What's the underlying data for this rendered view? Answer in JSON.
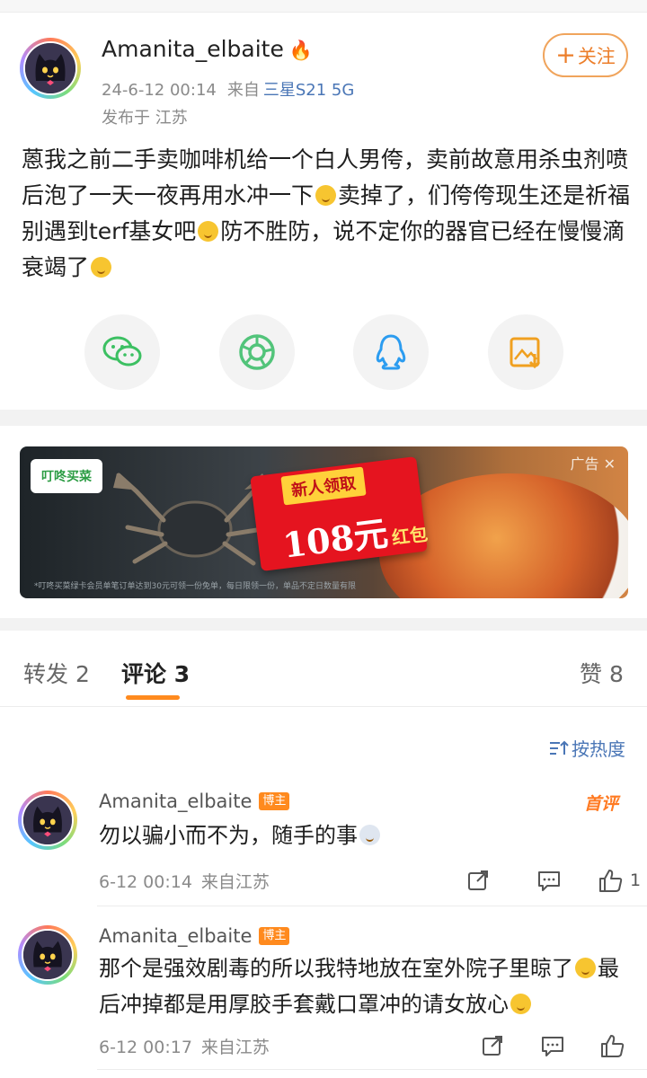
{
  "post": {
    "username": "Amanita_elbaite",
    "time": "24-6-12 00:14",
    "from_label": "来自",
    "device": "三星S21 5G",
    "location": "发布于 江苏",
    "follow_label": "关注",
    "text_parts": [
      "蒽我之前二手卖咖啡机给一个白人男侉，卖前故意用杀虫剂喷后泡了一天一夜再用水冲一下",
      "卖掉了，们侉侉现生还是祈福别遇到terf基女吧",
      "防不胜防，说不定你的器官已经在慢慢滴衰竭了"
    ]
  },
  "share_icons": [
    "wechat-icon",
    "moments-icon",
    "qq-icon",
    "save-image-icon"
  ],
  "ad": {
    "brand": "叮咚买菜",
    "tag": "新人领取",
    "amount": "108元",
    "amount_suffix": "红包",
    "label": "广告",
    "fine_print": "*叮咚买菜绿卡会员单笔订单达到30元可领一份免单，每日限领一份，单品不定日数量有限"
  },
  "tabs": {
    "repost": "转发 2",
    "comments": "评论 3",
    "likes": "赞 8"
  },
  "sort_label": "按热度",
  "first_review_label": "首评",
  "comments": [
    {
      "username": "Amanita_elbaite",
      "badge": "博主",
      "text_parts": [
        "勿以骗小而不为，随手的事"
      ],
      "time": "6-12 00:14",
      "from": "来自江苏",
      "like_count": "1"
    },
    {
      "username": "Amanita_elbaite",
      "badge": "博主",
      "text_parts": [
        "那个是强效剧毒的所以我特地放在室外院子里晾了",
        "最后冲掉都是用厚胶手套戴口罩冲的请女放心"
      ],
      "time": "6-12 00:17",
      "from": "来自江苏",
      "like_count": ""
    }
  ]
}
